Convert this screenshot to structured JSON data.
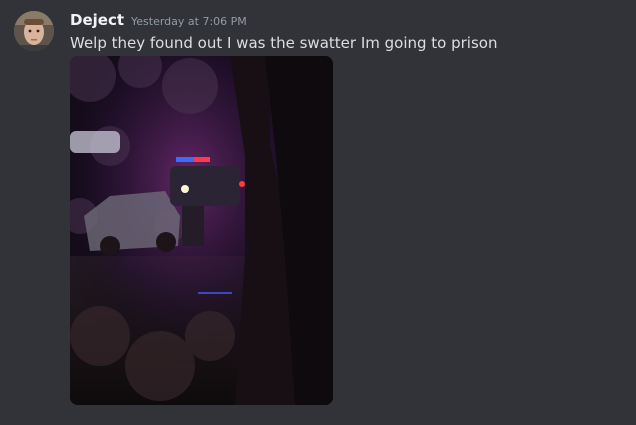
{
  "message": {
    "username": "Deject",
    "timestamp": "Yesterday at 7:06 PM",
    "content": "Welp they found out I was the swatter Im going to prison",
    "attachment": {
      "type": "image",
      "subject": "night photo of police cars with flashing lights behind trees"
    }
  },
  "colors": {
    "background": "#313338",
    "username": "#f2f3f5",
    "timestamp": "#949ba4",
    "text": "#dbdee1"
  }
}
